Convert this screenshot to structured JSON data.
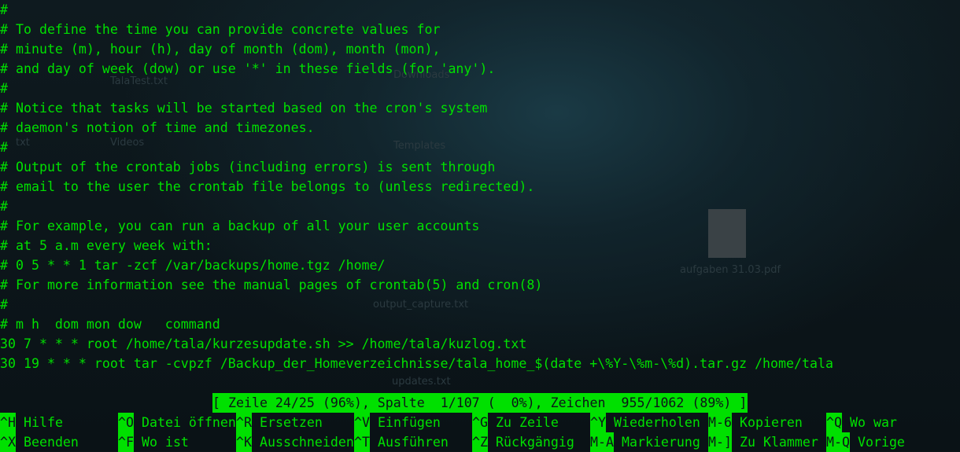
{
  "editor": {
    "lines": [
      "#",
      "# To define the time you can provide concrete values for",
      "# minute (m), hour (h), day of month (dom), month (mon),",
      "# and day of week (dow) or use '*' in these fields (for 'any').",
      "#",
      "# Notice that tasks will be started based on the cron's system",
      "# daemon's notion of time and timezones.",
      "#",
      "# Output of the crontab jobs (including errors) is sent through",
      "# email to the user the crontab file belongs to (unless redirected).",
      "#",
      "# For example, you can run a backup of all your user accounts",
      "# at 5 a.m every week with:",
      "# 0 5 * * 1 tar -zcf /var/backups/home.tgz /home/",
      "# For more information see the manual pages of crontab(5) and cron(8)",
      "#",
      "# m h  dom mon dow   command",
      "30 7 * * * root /home/tala/kurzesupdate.sh >> /home/tala/kuzlog.txt",
      "30 19 * * * root tar -cvpzf /Backup_der_Homeverzeichnisse/tala_home_$(date +\\%Y-\\%m-\\%d).tar.gz /home/tala"
    ]
  },
  "status_bar": "[ Zeile 24/25 (96%), Spalte  1/107 (  0%), Zeichen  955/1062 (89%) ]",
  "shortcuts_row1": [
    {
      "key": "^H",
      "label": "Hilfe"
    },
    {
      "key": "^O",
      "label": "Datei öffnen"
    },
    {
      "key": "^R",
      "label": "Ersetzen"
    },
    {
      "key": "^V",
      "label": "Einfügen"
    },
    {
      "key": "^G",
      "label": "Zu Zeile"
    },
    {
      "key": "^Y",
      "label": "Wiederholen"
    },
    {
      "key": "M-6",
      "label": "Kopieren"
    },
    {
      "key": "^Q",
      "label": "Wo war"
    }
  ],
  "shortcuts_row2": [
    {
      "key": "^X",
      "label": "Beenden"
    },
    {
      "key": "^F",
      "label": "Wo ist"
    },
    {
      "key": "^K",
      "label": "Ausschneiden"
    },
    {
      "key": "^T",
      "label": "Ausführen"
    },
    {
      "key": "^Z",
      "label": "Rückgängig"
    },
    {
      "key": "M-A",
      "label": "Markierung"
    },
    {
      "key": "M-]",
      "label": "Zu Klammer"
    },
    {
      "key": "M-Q",
      "label": "Vorige"
    }
  ],
  "desktop_ghost": {
    "items": [
      "TalaTest.txt",
      "Downloads",
      "Templates",
      "txt",
      "Videos",
      "aufgaben 31.03.pdf",
      "output_capture.txt",
      "updates.txt"
    ]
  },
  "colors": {
    "terminal_text": "#00e000",
    "terminal_bg": "#0c1418"
  }
}
